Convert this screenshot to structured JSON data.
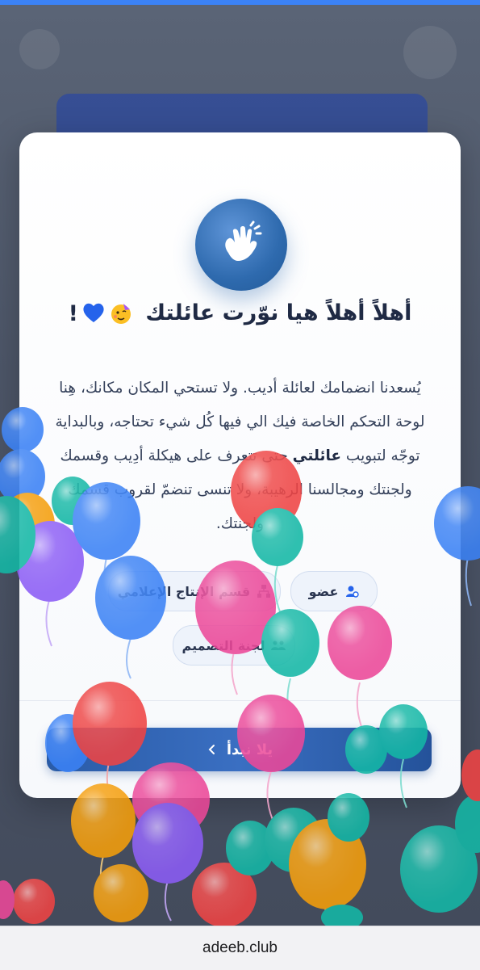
{
  "modal": {
    "title": "أهلاً أهلاً هيا نوّرت عائلتك",
    "title_emojis": [
      "party-face",
      "blue-heart",
      "exclamation"
    ],
    "title_exclaim": "!",
    "body_part1": "يُسعدنا انضمامك لعائلة أديب. ولا تستحي المكان مكانك، هِنا لوحة التحكم الخاصة فيك الي فيها كُل شيء تحتاجه، وبالبداية توجّه لتبويب ",
    "body_bold": "عائلتي",
    "body_part2": " حتى تتعرف على هيكلة أدِيب وقسمك ولجنتك ومجالسنا الرهيبة، ولا تنسى تنضمّ لقروب قسمك ولجنتك.",
    "chips": [
      {
        "label": "عضو",
        "icon": "member-icon"
      },
      {
        "label": "قسم الإنتاج الإعلامي",
        "icon": "org-chart-icon"
      },
      {
        "label": "لجنة التصميم",
        "icon": "team-icon"
      }
    ],
    "start_button": "يلا نبدأ",
    "start_icon": "arrow-icon"
  },
  "browser": {
    "url": "adeeb.club"
  },
  "colors": {
    "accent": "#2e6aae",
    "button": "#2a5ba6",
    "balloon_blue": "#3b82f6",
    "balloon_red": "#ef4444",
    "balloon_pink": "#ec4899",
    "balloon_teal": "#14b8a6",
    "balloon_purple": "#8b5cf6",
    "balloon_orange": "#f59e0b"
  }
}
